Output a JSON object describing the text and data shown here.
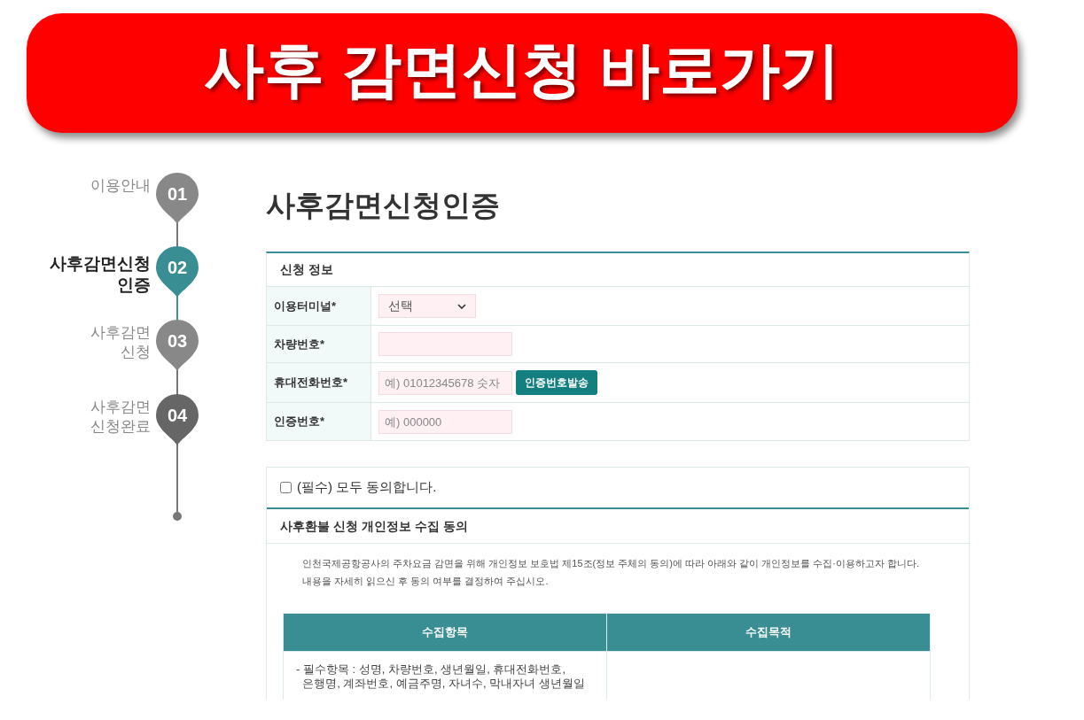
{
  "banner": {
    "title": "사후 감면신청 바로가기"
  },
  "steps": [
    {
      "label": "이용안내",
      "number": "01",
      "selected": false,
      "color": "#888888"
    },
    {
      "label": "사후감면신청\n인증",
      "number": "02",
      "selected": true,
      "color": "#388e93"
    },
    {
      "label": "사후감면\n신청",
      "number": "03",
      "selected": false,
      "color": "#888888"
    },
    {
      "label": "사후감면\n신청완료",
      "number": "04",
      "selected": false,
      "color": "#666666"
    }
  ],
  "page_title": "사후감면신청인증",
  "form": {
    "heading": "신청 정보",
    "rows": [
      {
        "kind": "select",
        "label": "이용터미널*",
        "value": "선택"
      },
      {
        "kind": "input",
        "label": "차량번호*"
      },
      {
        "kind": "input",
        "label": "휴대전화번호*",
        "placeholder": "예) 01012345678 숫자",
        "button": "인증번호발송"
      },
      {
        "kind": "input",
        "label": "인증번호*",
        "placeholder": "예) 000000"
      }
    ]
  },
  "agreement": {
    "all_label": "(필수) 모두 동의합니다.",
    "checked": false,
    "section_title": "사후환불 신청 개인정보 수집 동의",
    "intro": [
      "인천국제공항공사의 주차요금 감면을 위해 개인정보 보호법 제15조(정보 주체의 동의)에 따라 아래와 같이 개인정보를 수집·이용하고자 합니다.",
      "내용을 자세히 읽으신 후 동의 여부를 결정하여 주십시오."
    ],
    "table": {
      "columns": [
        "수집항목",
        "수집목적"
      ],
      "rows": [
        [
          "- 필수항목 : 성명, 차량번호, 생년월일, 휴대전화번호,\n  은행명, 계좌번호, 예금주명, 자녀수, 막내자녀 생년월일",
          ""
        ]
      ]
    }
  }
}
